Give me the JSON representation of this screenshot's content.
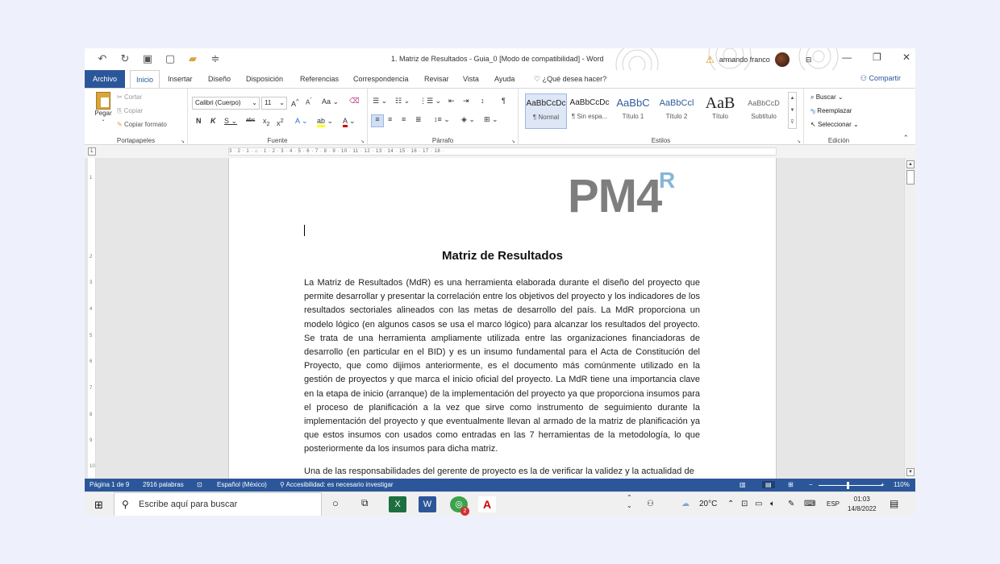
{
  "titlebar": {
    "doc_title": "1. Matriz de Resultados - Guia_0 [Modo de compatibilidad] - Word",
    "user_name": "armando franco"
  },
  "tabs": {
    "archivo": "Archivo",
    "items": [
      "Inicio",
      "Insertar",
      "Diseño",
      "Disposición",
      "Referencias",
      "Correspondencia",
      "Revisar",
      "Vista",
      "Ayuda"
    ],
    "tell_me": "¿Qué desea hacer?",
    "share": "Compartir"
  },
  "ribbon": {
    "clipboard": {
      "label": "Portapapeles",
      "paste": "Pegar",
      "cut": "Cortar",
      "copy": "Copiar",
      "format_painter": "Copiar formato"
    },
    "font": {
      "label": "Fuente",
      "family": "Calibri (Cuerpo)",
      "size": "11"
    },
    "paragraph": {
      "label": "Párrafo"
    },
    "styles": {
      "label": "Estilos",
      "items": [
        {
          "preview": "AaBbCcDc",
          "name": "¶ Normal"
        },
        {
          "preview": "AaBbCcDc",
          "name": "¶ Sin espa..."
        },
        {
          "preview": "AaBbC",
          "name": "Título 1"
        },
        {
          "preview": "AaBbCcl",
          "name": "Título 2"
        },
        {
          "preview": "AaB",
          "name": "Título"
        },
        {
          "preview": "AaBbCcD",
          "name": "Subtítulo"
        }
      ]
    },
    "editing": {
      "label": "Edición",
      "find": "Buscar",
      "replace": "Reemplazar",
      "select": "Seleccionar"
    }
  },
  "ruler": {
    "marks": "3 · 2 · 1 · ⌂ · 1 · 2 · 3 · 4 · 5 · 6 · 7 · 8 · 9 · 10 · 11 · 12 · 13 · 14 · 15 · 16 · 17 · 18 ·"
  },
  "document": {
    "logo": "PM4",
    "logo_sup": "R",
    "heading": "Matriz de Resultados",
    "paragraph1": "La Matriz de Resultados (MdR) es una herramienta elaborada durante el diseño del proyecto que permite desarrollar y presentar la correlación entre los objetivos del proyecto y los indicadores de los resultados sectoriales alineados con las metas de desarrollo del país. La MdR proporciona un modelo lógico (en algunos casos se usa el marco lógico) para alcanzar los resultados del proyecto. Se trata de una herramienta ampliamente utilizada entre las organizaciones financiadoras de desarrollo (en particular en el BID) y es un insumo fundamental para el Acta de Constitución del Proyecto, que como dijimos anteriormente, es el documento más comúnmente utilizado en la gestión de proyectos y que marca el inicio oficial del proyecto. La MdR tiene una importancia clave en la etapa de inicio (arranque) de la implementación del proyecto ya que proporciona insumos para el proceso de planificación a la vez que sirve como instrumento de seguimiento durante la implementación del proyecto y que eventualmente llevan al armado de la matriz de planificación ya que estos insumos con usados como entradas en las 7 herramientas de la metodología, lo que posteriormente da los insumos para dicha matriz.",
    "paragraph2": "Una de las responsabilidades del gerente de proyecto es la de verificar la validez y la actualidad de"
  },
  "statusbar": {
    "page": "Página 1 de 9",
    "words": "2916 palabras",
    "language": "Español (México)",
    "accessibility": "Accesibilidad: es necesario investigar",
    "zoom": "110%",
    "zoom_level_percent": 110
  },
  "taskbar": {
    "search_placeholder": "Escribe aquí para buscar",
    "temperature": "20°C",
    "lang": "ESP",
    "time": "01:03",
    "date": "14/8/2022",
    "badge": "2"
  },
  "colors": {
    "word_blue": "#2b579a",
    "excel_green": "#1d6f42",
    "logo_grey": "#7e7e7e",
    "logo_blue": "#86b6d6"
  }
}
